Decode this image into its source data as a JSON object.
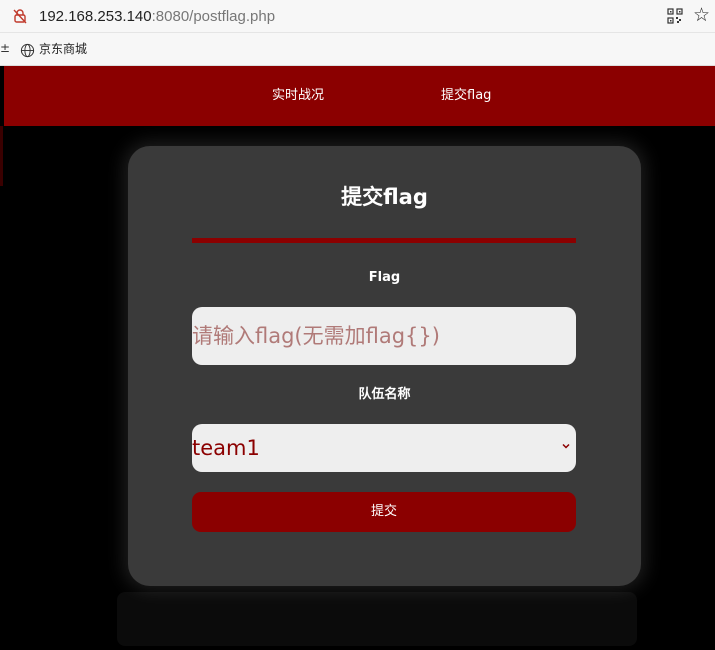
{
  "browser": {
    "url_host": "192.168.253.140",
    "url_rest": ":8080/postflag.php",
    "bookmark_label": "京东商城",
    "icons": [
      "not-secure-icon",
      "qr-code-icon",
      "bookmark-star-icon",
      "globe-icon"
    ]
  },
  "nav": {
    "items": [
      {
        "label": "实时战况"
      },
      {
        "label": "提交flag"
      }
    ]
  },
  "form": {
    "title": "提交flag",
    "flag_label": "Flag",
    "flag_placeholder": "请输入flag(无需加flag{})",
    "team_label": "队伍名称",
    "team_selected": "team1",
    "submit_label": "提交"
  },
  "colors": {
    "accent": "#8b0000",
    "card_bg": "#3a3a3a",
    "page_bg": "#000000",
    "input_bg": "#eeeeee"
  }
}
